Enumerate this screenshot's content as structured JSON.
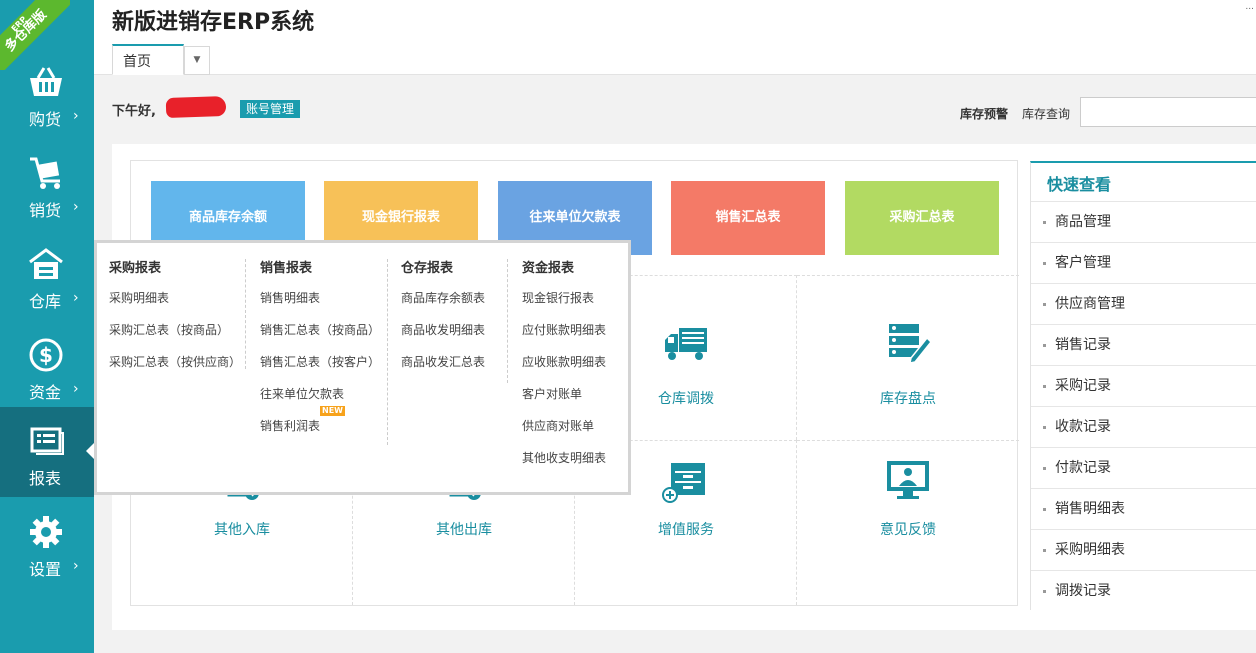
{
  "ribbon": {
    "small": "ERP",
    "text": "多仓库版"
  },
  "sidebar": {
    "items": [
      {
        "label": "购货",
        "icon": "basket-icon"
      },
      {
        "label": "销货",
        "icon": "cart-icon"
      },
      {
        "label": "仓库",
        "icon": "warehouse-icon"
      },
      {
        "label": "资金",
        "icon": "dollar-icon"
      },
      {
        "label": "报表",
        "icon": "report-icon"
      },
      {
        "label": "设置",
        "icon": "gear-icon"
      }
    ],
    "chevron": "›"
  },
  "header": {
    "title": "新版进销存ERP系统",
    "tab_label": "首页",
    "tab_dropdown": "▼",
    "corner_mark": "..."
  },
  "greeting": {
    "text": "下午好,",
    "account_button": "账号管理"
  },
  "stock": {
    "alert_label": "库存预警",
    "query_label": "库存查询",
    "query_value": ""
  },
  "tiles": [
    {
      "label": "商品库存余额",
      "color": "#62b6ec"
    },
    {
      "label": "现金银行报表",
      "color": "#f7c158"
    },
    {
      "label": "往来单位欠款表",
      "color": "#6aa3e2"
    },
    {
      "label": "销售汇总表",
      "color": "#f47a67"
    },
    {
      "label": "采购汇总表",
      "color": "#b2da62"
    }
  ],
  "grid": [
    {
      "label": "仓库调拨",
      "icon": "truck-icon"
    },
    {
      "label": "库存盘点",
      "icon": "inventory-check-icon"
    },
    {
      "label": "其他入库",
      "icon": "other-inbound-icon"
    },
    {
      "label": "其他出库",
      "icon": "other-outbound-icon"
    },
    {
      "label": "增值服务",
      "icon": "value-added-icon"
    },
    {
      "label": "意见反馈",
      "icon": "feedback-icon"
    }
  ],
  "quick": {
    "title": "快速查看",
    "items": [
      "商品管理",
      "客户管理",
      "供应商管理",
      "销售记录",
      "采购记录",
      "收款记录",
      "付款记录",
      "销售明细表",
      "采购明细表",
      "调拨记录"
    ]
  },
  "report_menu": {
    "columns": [
      {
        "title": "采购报表",
        "items": [
          "采购明细表",
          "采购汇总表（按商品）",
          "采购汇总表（按供应商）"
        ]
      },
      {
        "title": "销售报表",
        "items": [
          "销售明细表",
          "销售汇总表（按商品）",
          "销售汇总表（按客户）",
          "往来单位欠款表",
          "销售利润表"
        ]
      },
      {
        "title": "仓存报表",
        "items": [
          "商品库存余额表",
          "商品收发明细表",
          "商品收发汇总表"
        ]
      },
      {
        "title": "资金报表",
        "items": [
          "现金银行报表",
          "应付账款明细表",
          "应收账款明细表",
          "客户对账单",
          "供应商对账单",
          "其他收支明细表"
        ]
      }
    ],
    "new_badge": "NEW"
  },
  "colors": {
    "accent": "#1a9cae",
    "accent_dark": "#156f7f",
    "ribbon": "#5cb82e"
  }
}
